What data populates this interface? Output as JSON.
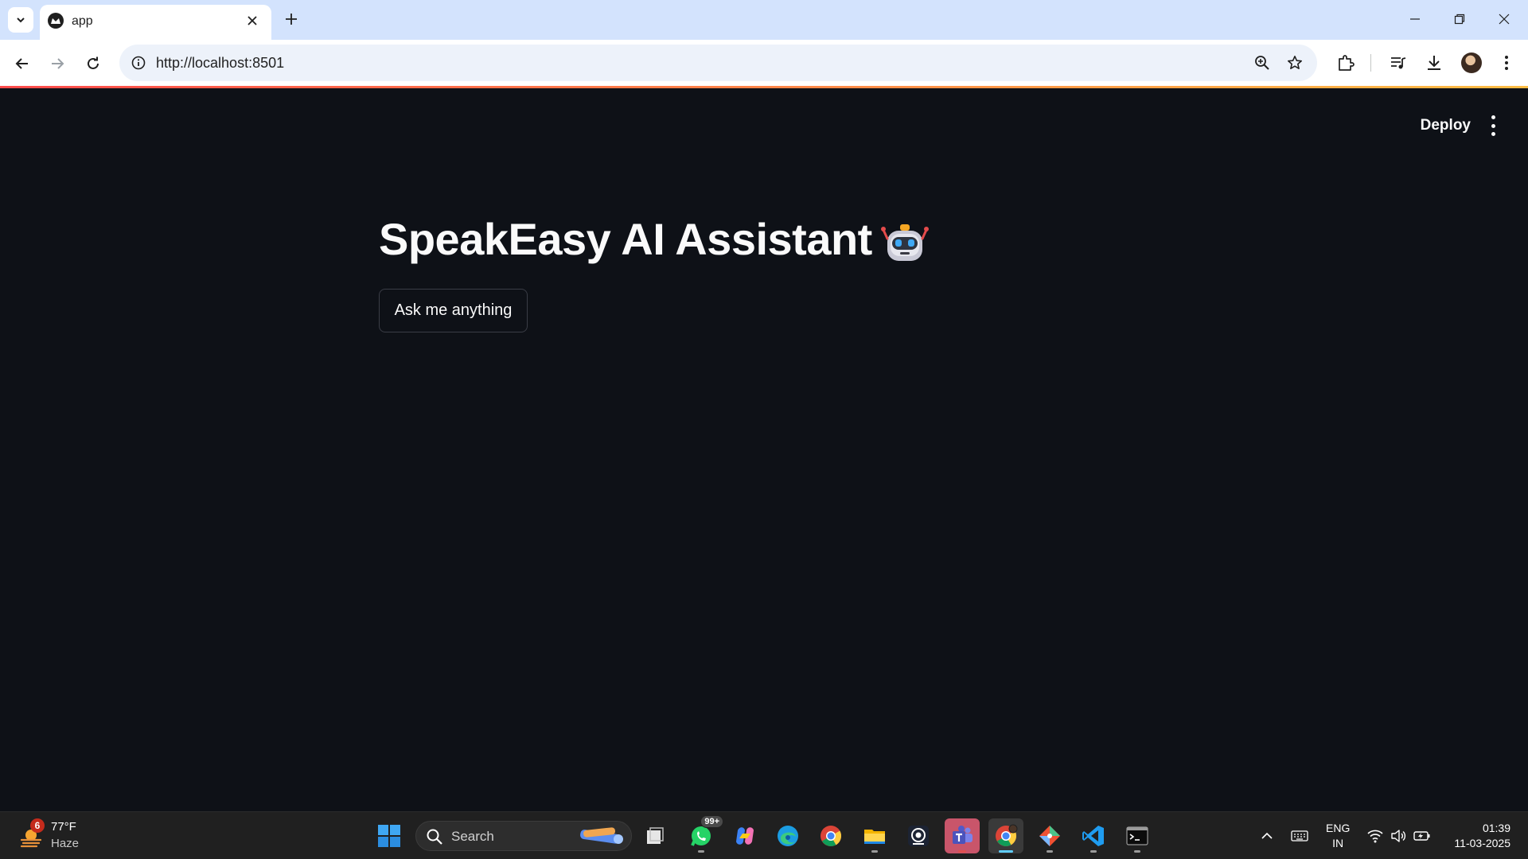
{
  "browser": {
    "tab_title": "app",
    "url": "http://localhost:8501"
  },
  "app": {
    "deploy_label": "Deploy",
    "title": "SpeakEasy AI Assistant",
    "title_icon": "robot-emoji",
    "button_label": "Ask me anything",
    "accent_gradient": [
      "#ff4b4b",
      "#ffbd45"
    ],
    "background": "#0e1117"
  },
  "taskbar": {
    "weather": {
      "badge": "6",
      "temperature": "77°F",
      "condition": "Haze"
    },
    "search_label": "Search",
    "whatsapp_badge": "99+",
    "apps": [
      "start-icon",
      "file-explorer-icon",
      "whatsapp-icon",
      "copilot-icon",
      "edge-icon",
      "chrome-icon",
      "folder-icon",
      "camera-app-icon",
      "teams-icon",
      "chrome-profile-icon",
      "git-icon",
      "vscode-icon",
      "terminal-icon"
    ],
    "language": {
      "line1": "ENG",
      "line2": "IN"
    },
    "time": "01:39",
    "date": "11-03-2025"
  }
}
